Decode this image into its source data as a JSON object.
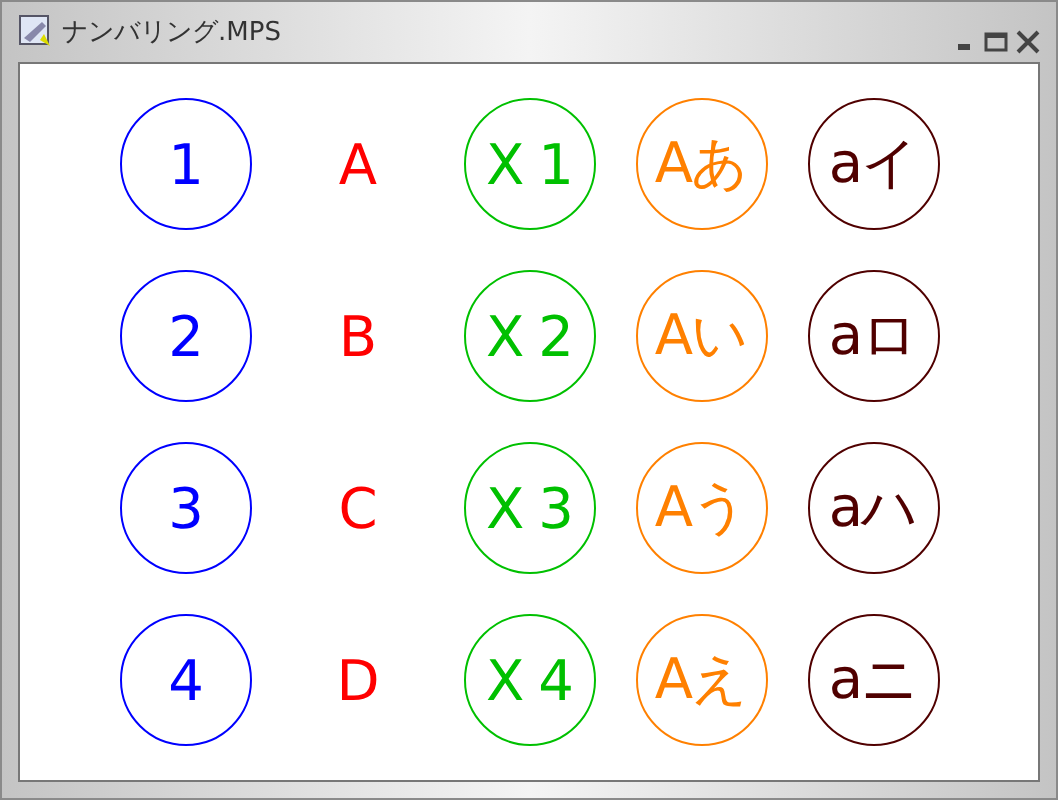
{
  "window": {
    "title": "ナンバリング.MPS"
  },
  "columns": [
    {
      "color": "#0000ff",
      "circled": true,
      "labels": [
        "1",
        "2",
        "3",
        "4"
      ]
    },
    {
      "color": "#ff0000",
      "circled": false,
      "labels": [
        "A",
        "B",
        "C",
        "D"
      ]
    },
    {
      "color": "#00c000",
      "circled": true,
      "labels": [
        "X 1",
        "X 2",
        "X 3",
        "X 4"
      ]
    },
    {
      "color": "#ff8000",
      "circled": true,
      "labels": [
        "Aあ",
        "Aい",
        "Aう",
        "Aえ"
      ]
    },
    {
      "color": "#500000",
      "circled": true,
      "labels": [
        "aイ",
        "aロ",
        "aハ",
        "aニ"
      ]
    }
  ]
}
